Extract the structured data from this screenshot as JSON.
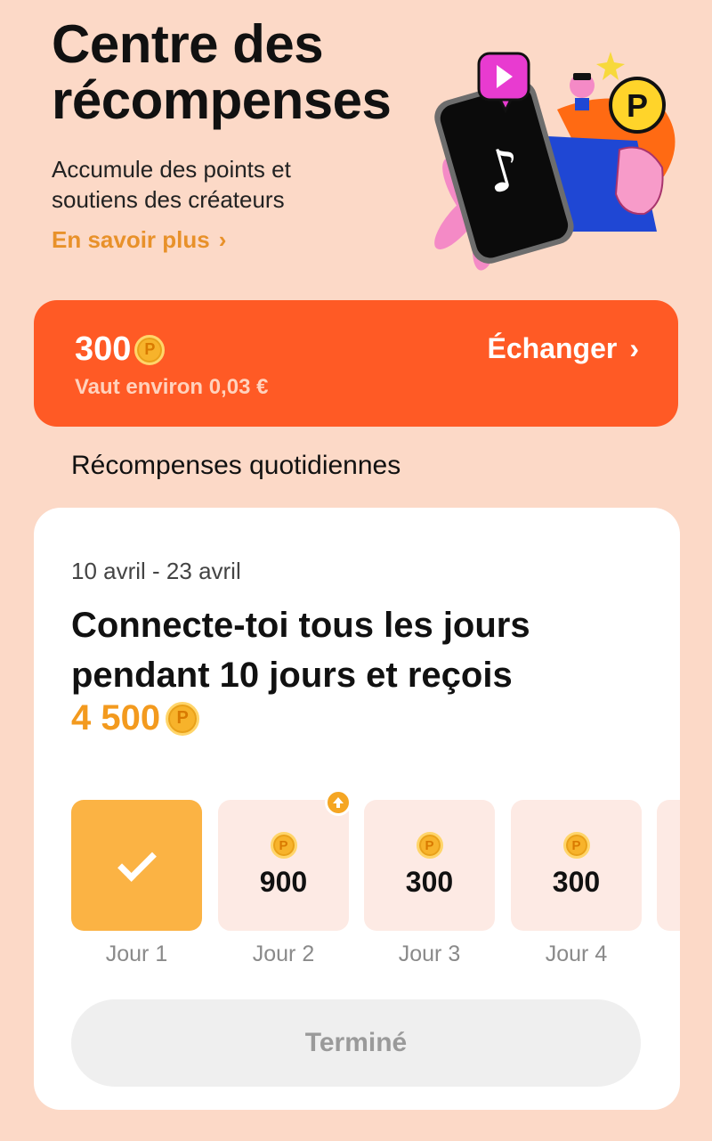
{
  "header": {
    "title": "Centre des récompenses",
    "subtitle": "Accumule des points et soutiens des créateurs",
    "learn_more": "En savoir plus"
  },
  "balance": {
    "points": "300",
    "worth": "Vaut environ 0,03 €",
    "exchange_label": "Échanger"
  },
  "section_title": "Récompenses quotidiennes",
  "card": {
    "dates": "10 avril - 23 avril",
    "headline": "Connecte-toi tous les jours pendant 10 jours et reçois",
    "reward": "4 500",
    "days": [
      {
        "label": "Jour 1",
        "value": "",
        "state": "done"
      },
      {
        "label": "Jour 2",
        "value": "900",
        "state": "boost"
      },
      {
        "label": "Jour 3",
        "value": "300",
        "state": "pending"
      },
      {
        "label": "Jour 4",
        "value": "300",
        "state": "pending"
      }
    ],
    "button_label": "Terminé"
  },
  "coin_symbol": "P",
  "colors": {
    "background": "#fcd9c7",
    "banner": "#ff5a25",
    "accent": "#f39a1e",
    "done_tile": "#fbb344",
    "pending_tile": "#fdeae4"
  },
  "icons": [
    "coin-icon",
    "chevron-right-icon",
    "check-icon",
    "boost-arrow-icon",
    "tiktok-logo-icon"
  ]
}
